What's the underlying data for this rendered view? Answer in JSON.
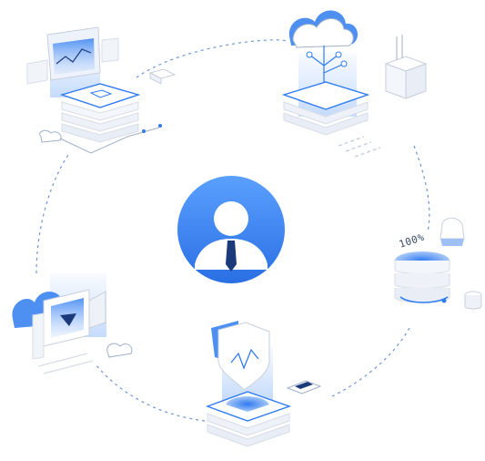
{
  "diagram": {
    "center_icon": "user-avatar-icon",
    "percent_label": "100%",
    "colors": {
      "primary_blue": "#2f7bf0",
      "light_blue": "#8fbaf5",
      "pale_blue": "#e6effd",
      "line_gray": "#c7cfdc",
      "dash_blue": "#6f95d6",
      "dark_navy": "#1b3a7a"
    },
    "nodes": [
      {
        "icon": "laptop-server-icon"
      },
      {
        "icon": "cloud-network-icon"
      },
      {
        "icon": "database-pie-chart-icon"
      },
      {
        "icon": "shield-security-icon"
      },
      {
        "icon": "video-camera-cloud-icon"
      }
    ]
  }
}
